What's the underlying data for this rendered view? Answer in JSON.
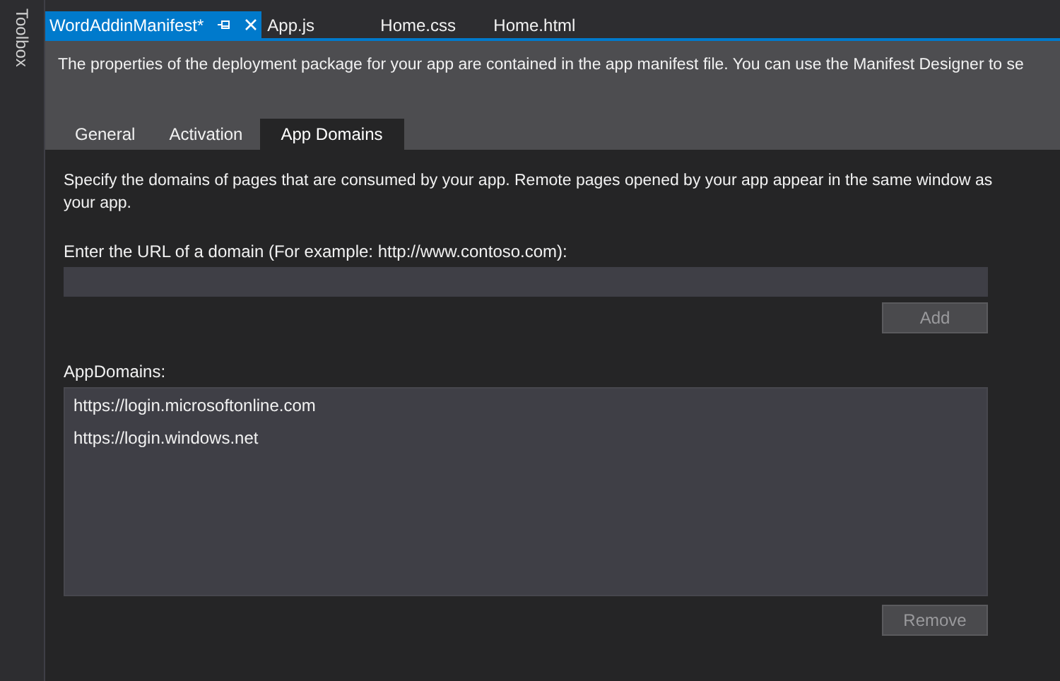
{
  "toolbox": {
    "label": "Toolbox"
  },
  "doc_tabs": [
    {
      "label": "WordAddinManifest*",
      "selected": true
    },
    {
      "label": "App.js",
      "selected": false
    },
    {
      "label": "Home.css",
      "selected": false
    },
    {
      "label": "Home.html",
      "selected": false
    }
  ],
  "header": {
    "description": "The properties of the deployment package for your app are contained in the app manifest file. You can use the Manifest Designer to se"
  },
  "tabs": [
    {
      "label": "General",
      "selected": false
    },
    {
      "label": "Activation",
      "selected": false
    },
    {
      "label": "App Domains",
      "selected": true
    }
  ],
  "intro": "Specify the domains of pages that are consumed by your app. Remote pages opened by your app appear in the same window as your app.",
  "url_field": {
    "label": "Enter the URL of a domain (For example: http://www.contoso.com):"
  },
  "add_button": {
    "label": "Add",
    "disabled": true
  },
  "domains": {
    "label": "AppDomains:",
    "items": [
      "https://login.microsoftonline.com",
      "https://login.windows.net"
    ]
  },
  "remove_button": {
    "label": "Remove",
    "disabled": true
  }
}
